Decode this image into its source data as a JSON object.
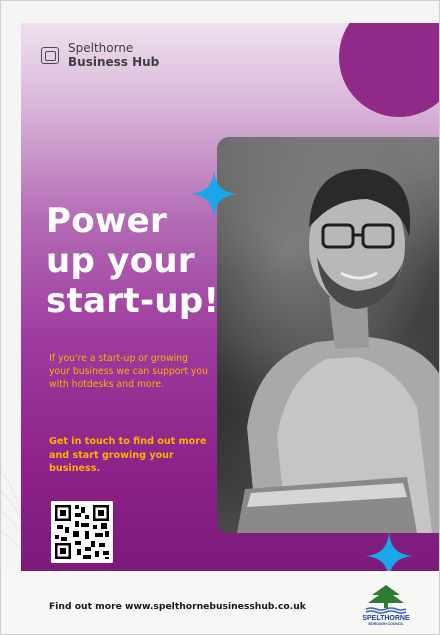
{
  "logo": {
    "line1": "Spelthorne",
    "line2": "Business Hub"
  },
  "headline": {
    "line1": "Power",
    "line2": "up your",
    "line3": "start-up!"
  },
  "intro_text": "If you're a start-up or growing your business we can support you with hotdesks and more.",
  "cta_text": "Get in touch to find out more and start growing your business.",
  "footer": {
    "text": "Find out more www.spelthornebusinesshub.co.uk",
    "council_name": "SPELTHORNE",
    "council_sub": "BOROUGH COUNCIL"
  },
  "colors": {
    "purple_dark": "#7c1a7a",
    "purple_circle": "#8f2a88",
    "accent_yellow": "#ffb000",
    "star_blue": "#1aa6ea"
  },
  "icons": {
    "logo_icon": "business-hub-logo-icon",
    "star_icon": "sparkle-star-icon",
    "qr_code": "qr-code-icon",
    "council_logo": "spelthorne-council-logo"
  }
}
